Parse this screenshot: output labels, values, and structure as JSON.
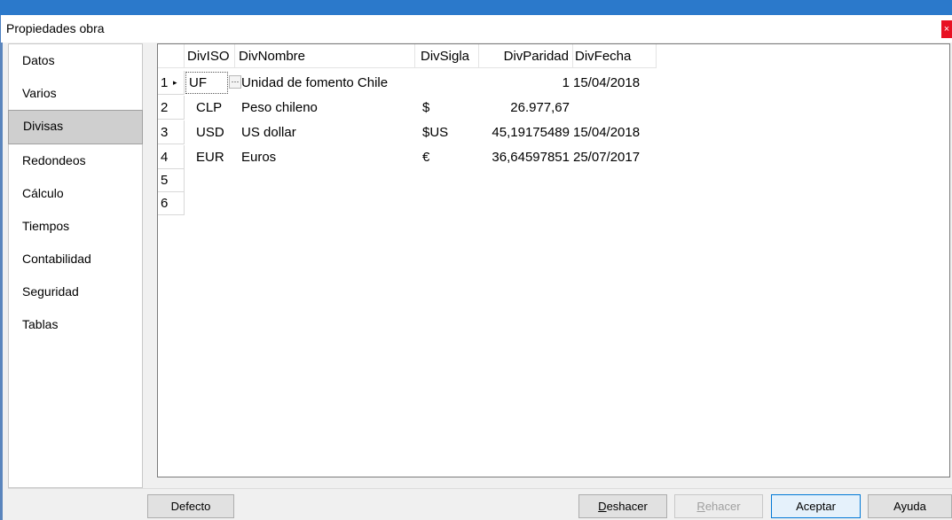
{
  "window": {
    "title": "Propiedades obra",
    "close_glyph": "×"
  },
  "sidebar": {
    "items": [
      {
        "label": "Datos"
      },
      {
        "label": "Varios"
      },
      {
        "label": "Divisas"
      },
      {
        "label": "Redondeos"
      },
      {
        "label": "Cálculo"
      },
      {
        "label": "Tiempos"
      },
      {
        "label": "Contabilidad"
      },
      {
        "label": "Seguridad"
      },
      {
        "label": "Tablas"
      }
    ],
    "selected_index": 2
  },
  "table": {
    "columns": [
      "DivISO",
      "DivNombre",
      "DivSigla",
      "DivParidad",
      "DivFecha"
    ],
    "rows": [
      {
        "num": "1",
        "iso": "UF",
        "nombre": "Unidad de fomento Chile",
        "sigla": "",
        "paridad": "1",
        "fecha": "15/04/2018"
      },
      {
        "num": "2",
        "iso": "CLP",
        "nombre": "Peso chileno",
        "sigla": "$",
        "paridad": "26.977,67",
        "fecha": ""
      },
      {
        "num": "3",
        "iso": "USD",
        "nombre": "US dollar",
        "sigla": "$US",
        "paridad": "45,19175489",
        "fecha": "15/04/2018"
      },
      {
        "num": "4",
        "iso": "EUR",
        "nombre": "Euros",
        "sigla": "€",
        "paridad": "36,64597851",
        "fecha": "25/07/2017"
      },
      {
        "num": "5",
        "iso": "",
        "nombre": "",
        "sigla": "",
        "paridad": "",
        "fecha": ""
      },
      {
        "num": "6",
        "iso": "",
        "nombre": "",
        "sigla": "",
        "paridad": "",
        "fecha": ""
      }
    ],
    "current_row_marker": "▸",
    "ellipsis_label": "···"
  },
  "buttons": {
    "defecto": "Defecto",
    "deshacer_u": "D",
    "deshacer_rest": "eshacer",
    "rehacer_u": "R",
    "rehacer_rest": "ehacer",
    "aceptar": "Aceptar",
    "ayuda": "Ayuda"
  },
  "colors": {
    "accent": "#2b79cb",
    "close": "#e81123",
    "selected": "#cfcfcf"
  }
}
